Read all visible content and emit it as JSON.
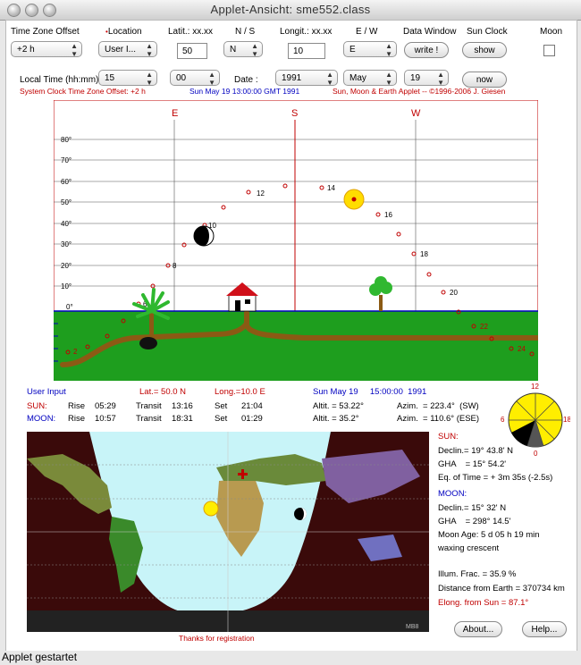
{
  "window": {
    "title": "Applet-Ansicht: sme552.class",
    "status": "Applet gestartet"
  },
  "controls": {
    "tz_label": "Time Zone Offset",
    "tz_value": "+2 h",
    "location_label": "Location",
    "location_value": "User I...",
    "lat_label": "Latit.: xx.xx",
    "lat_value": "50",
    "ns_label": "N / S",
    "ns_value": "N",
    "lon_label": "Longit.: xx.xx",
    "lon_value": "10",
    "ew_label": "E / W",
    "ew_value": "E",
    "datawin_label": "Data Window",
    "write_button": "write !",
    "sunclock_label": "Sun Clock",
    "show_button": "show",
    "moon_label": "Moon",
    "localtime_label": "Local Time (hh:mm)",
    "hour_value": "15",
    "minute_value": "00",
    "date_label": "Date :",
    "year_value": "1991",
    "month_value": "May",
    "day_value": "19",
    "now_button": "now"
  },
  "sysclock": {
    "left": "System Clock Time Zone Offset: +2 h",
    "mid": "Sun May 19 13:00:00 GMT 1991",
    "right": "Sun, Moon & Earth Applet -- ©1996-2006 J. Giesen"
  },
  "sky": {
    "directions": [
      "E",
      "S",
      "W"
    ],
    "alt_labels": [
      "80°",
      "70°",
      "60°",
      "50°",
      "40°",
      "30°",
      "20°",
      "10°",
      "0°"
    ],
    "hour_labels": [
      "6",
      "8",
      "10",
      "12",
      "14",
      "16",
      "18",
      "20",
      "22",
      "24",
      "2"
    ]
  },
  "ephem": {
    "user_input": "User Input",
    "lat": "Lat.= 50.0 N",
    "lon": "Long.=10.0 E",
    "datetime": "Sun May 19     15:00:00  1991",
    "sun_label": "SUN:",
    "sun_rise_l": "Rise",
    "sun_rise": "05:29",
    "sun_transit_l": "Transit",
    "sun_transit": "13:16",
    "sun_set_l": "Set",
    "sun_set": "21:04",
    "sun_alt": "Altit. = 53.22°",
    "sun_azim": "Azim.  = 223.4°  (SW)",
    "moon_label": "MOON:",
    "moon_rise_l": "Rise",
    "moon_rise": "10:57",
    "moon_transit_l": "Transit",
    "moon_transit": "18:31",
    "moon_set_l": "Set",
    "moon_set": "01:29",
    "moon_alt": "Altit. = 35.2°",
    "moon_azim": "Azim.  = 110.6° (ESE)"
  },
  "clock": {
    "n": "12",
    "e": "18",
    "s": "0",
    "w": "6"
  },
  "right_panel": {
    "sun_head": "SUN:",
    "sun_decl": "Declin.= 19° 43.8' N",
    "sun_gha": "GHA    = 15° 54.2'",
    "eq_time": "Eq. of Time = + 3m 35s (-2.5s)",
    "moon_head": "MOON:",
    "moon_decl": "Declin.= 15° 32' N",
    "moon_gha": "GHA    = 298° 14.5'",
    "moon_age": "Moon Age: 5 d 05 h 19 min",
    "moon_phase": "waxing crescent",
    "illum": "Illum. Frac.  = 35.9 %",
    "distance": "Distance from Earth = 370734 km",
    "elong": "Elong. from Sun = 87.1°"
  },
  "map": {
    "credit": "Thanks for registration",
    "tag": "MB8"
  },
  "buttons": {
    "about": "About...",
    "help": "Help..."
  },
  "colors": {
    "sky_grid": "#555555",
    "ground": "#1e9e1e",
    "path": "#8b5a14",
    "sun": "#ffdd00",
    "night": "#3a0a0a",
    "day_sky": "#c8f4f8",
    "red_text": "#c00000",
    "blue_text": "#0000c0"
  }
}
